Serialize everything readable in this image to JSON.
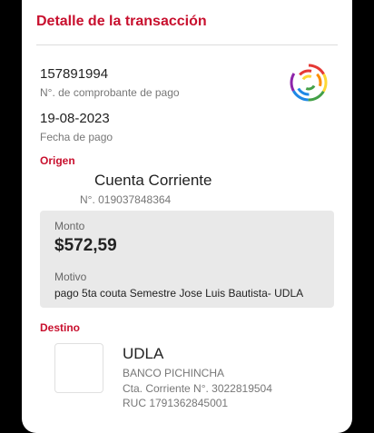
{
  "header": {
    "title": "Detalle de la transacción"
  },
  "receipt": {
    "number": "157891994",
    "number_label": "N°. de comprobante de pago",
    "date": "19-08-2023",
    "date_label": "Fecha de pago"
  },
  "origin": {
    "section_label": "Origen",
    "account_type": "Cuenta Corriente",
    "account_number": "N°. 019037848364"
  },
  "payment": {
    "amount_label": "Monto",
    "amount": "$572,59",
    "motive_label": "Motivo",
    "motive": "pago 5ta couta Semestre Jose Luis Bautista- UDLA"
  },
  "destination": {
    "section_label": "Destino",
    "name": "UDLA",
    "bank": "BANCO PICHINCHA",
    "account": "Cta. Corriente N°. 3022819504",
    "ruc": "RUC 1791362845001"
  },
  "colors": {
    "accent": "#c8102e",
    "card": "#ffffff",
    "panel": "#e9e9e9",
    "background": "#000000"
  }
}
